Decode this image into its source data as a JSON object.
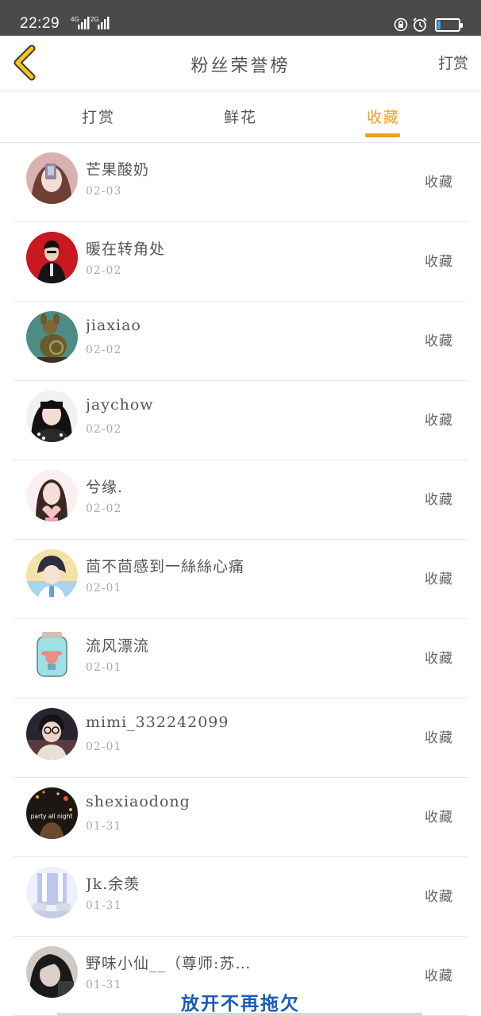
{
  "status_bar": {
    "time": "22:29",
    "network_1": "4G",
    "network_2": "2G",
    "icons": [
      "lock-rotation-icon",
      "alarm-icon",
      "battery-icon"
    ],
    "battery_color": "#3aa0ff"
  },
  "header": {
    "back_icon": "chevron-left-icon",
    "back_color": "#f0c81e",
    "title": "粉丝荣誉榜",
    "action": "打赏"
  },
  "tabs": [
    {
      "label": "打赏",
      "active": false
    },
    {
      "label": "鲜花",
      "active": false
    },
    {
      "label": "收藏",
      "active": true
    }
  ],
  "accent_color": "#f0a020",
  "fans": [
    {
      "name": "芒果酸奶",
      "date": "02-03",
      "type": "收藏"
    },
    {
      "name": "暖在转角处",
      "date": "02-02",
      "type": "收藏"
    },
    {
      "name": "jiaxiao",
      "date": "02-02",
      "type": "收藏"
    },
    {
      "name": "jaychow",
      "date": "02-02",
      "type": "收藏"
    },
    {
      "name": "兮缘.",
      "date": "02-02",
      "type": "收藏"
    },
    {
      "name": "茴不茴感到一絲絲心痛",
      "date": "02-01",
      "type": "收藏"
    },
    {
      "name": "流风漂流",
      "date": "02-01",
      "type": "收藏"
    },
    {
      "name": "mimi_332242099",
      "date": "02-01",
      "type": "收藏"
    },
    {
      "name": "shexiaodong",
      "date": "01-31",
      "type": "收藏"
    },
    {
      "name": "Jk.余羡",
      "date": "01-31",
      "type": "收藏"
    },
    {
      "name": "野味小仙__（尊师:苏…",
      "date": "01-31",
      "type": "收藏"
    }
  ],
  "avatar_text": {
    "shexiaodong": "party all night"
  },
  "watermark": "放开不再拖欠"
}
